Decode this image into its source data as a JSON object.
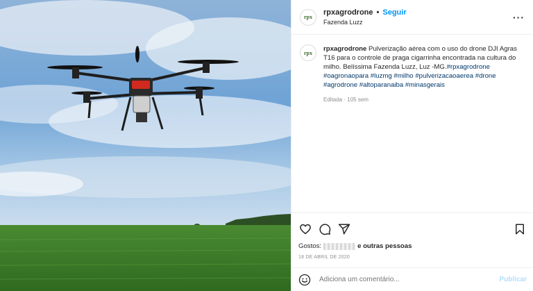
{
  "post": {
    "author": {
      "username": "rpxagrodrone",
      "avatar_text": "rpx",
      "follow_label": "Seguir",
      "location": "Fazenda Luzz"
    },
    "caption": {
      "username": "rpxagrodrone",
      "text": "Pulverização aérea com o uso do drone DJI Agras T16 para o controle de praga cigarrinha encontrada na cultura do milho. Belíssima Fazenda Luzz, Luz -MG.",
      "hashtags": [
        "#rpxagrodrone",
        "#oagronaopara",
        "#luzmg",
        "#milho",
        "#pulverizacaoaerea",
        "#drone",
        "#agrodrone",
        "#altoparanaiba",
        "#minasgerais"
      ],
      "meta": "Editada · 105 sem"
    },
    "likes": {
      "prefix": "Gostos:",
      "suffix": "e outras pessoas"
    },
    "date": "18 DE ABRIL DE 2020",
    "comment": {
      "placeholder": "Adiciona um comentário...",
      "publish_label": "Publicar"
    },
    "colors": {
      "link": "#0095f6",
      "hashtag": "#00376b",
      "muted": "#8e8e8e"
    },
    "icons": [
      "heart-icon",
      "comment-icon",
      "share-icon",
      "bookmark-icon",
      "more-options-icon",
      "emoji-icon"
    ]
  }
}
